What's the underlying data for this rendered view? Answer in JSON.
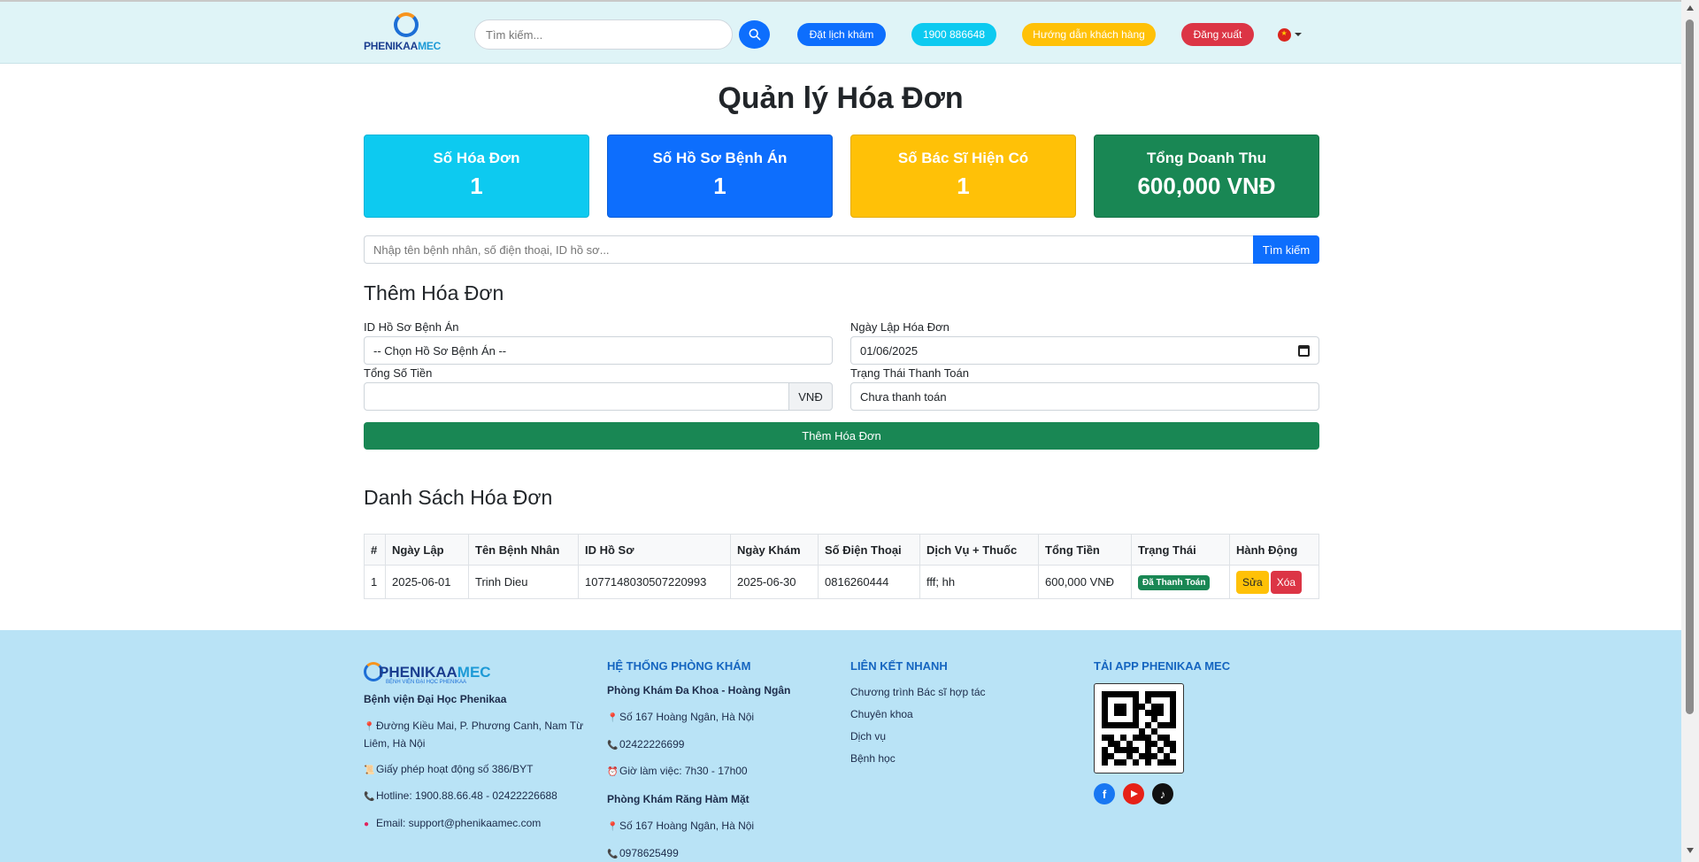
{
  "header": {
    "logo_main": "PHENIKAA",
    "logo_accent": "MEC",
    "search_placeholder": "Tìm kiếm...",
    "book_label": "Đặt lịch khám",
    "hotline_label": "1900 886648",
    "guide_label": "Hướng dẫn khách hàng",
    "logout_label": "Đăng xuất"
  },
  "page": {
    "title": "Quản lý Hóa Đơn"
  },
  "stats": [
    {
      "label": "Số Hóa Đơn",
      "value": "1",
      "color": "#0dcaf0"
    },
    {
      "label": "Số Hồ Sơ Bệnh Án",
      "value": "1",
      "color": "#0d6efd"
    },
    {
      "label": "Số Bác Sĩ Hiện Có",
      "value": "1",
      "color": "#ffc107"
    },
    {
      "label": "Tổng Doanh Thu",
      "value": "600,000 VNĐ",
      "color": "#198754"
    }
  ],
  "search": {
    "placeholder": "Nhập tên bệnh nhân, số điện thoại, ID hồ sơ...",
    "button": "Tìm kiếm"
  },
  "form": {
    "title": "Thêm Hóa Đơn",
    "record_label": "ID Hồ Sơ Bệnh Án",
    "record_value": "-- Chọn Hồ Sơ Bệnh Án --",
    "date_label": "Ngày Lập Hóa Đơn",
    "date_value": "01/06/2025",
    "amount_label": "Tổng Số Tiền",
    "amount_suffix": "VNĐ",
    "status_label": "Trạng Thái Thanh Toán",
    "status_value": "Chưa thanh toán",
    "submit": "Thêm Hóa Đơn"
  },
  "list": {
    "title": "Danh Sách Hóa Đơn",
    "columns": [
      "#",
      "Ngày Lập",
      "Tên Bệnh Nhân",
      "ID Hồ Sơ",
      "Ngày Khám",
      "Số Điện Thoại",
      "Dịch Vụ + Thuốc",
      "Tổng Tiền",
      "Trạng Thái",
      "Hành Động"
    ],
    "rows": [
      {
        "index": "1",
        "date": "2025-06-01",
        "patient": "Trinh Dieu",
        "record_id": "1077148030507220993",
        "visit_date": "2025-06-30",
        "phone": "0816260444",
        "services": "fff; hh",
        "total": "600,000 VNĐ",
        "status": "Đã Thanh Toán",
        "edit": "Sửa",
        "delete": "Xóa"
      }
    ]
  },
  "footer": {
    "logo_main": "PHENIKAA",
    "logo_accent": "MEC",
    "logo_sub": "BỆNH VIỆN ĐẠI HỌC PHENIKAA",
    "hospital": "Bệnh viện Đại Học Phenikaa",
    "address": "Đường Kiều Mai, P. Phương Canh, Nam Từ Liêm, Hà Nội",
    "license": "Giấy phép hoạt động số 386/BYT",
    "hotline": "Hotline: 1900.88.66.48 - 02422226688",
    "email": "Email: support@phenikaamec.com",
    "clinics_heading": "HỆ THỐNG PHÒNG KHÁM",
    "clinic1_name": "Phòng Khám Đa Khoa - Hoàng Ngân",
    "clinic1_address": "Số 167 Hoàng Ngân, Hà Nội",
    "clinic1_phone": "02422226699",
    "clinic1_hours": "Giờ làm việc: 7h30 - 17h00",
    "clinic2_name": "Phòng Khám Răng Hàm Mặt",
    "clinic2_address": "Số 167 Hoàng Ngân, Hà Nội",
    "clinic2_phone": "0978625499",
    "links_heading": "LIÊN KẾT NHANH",
    "links": [
      "Chương trình Bác sĩ hợp tác",
      "Chuyên khoa",
      "Dịch vụ",
      "Bệnh học"
    ],
    "app_heading": "TẢI APP PHENIKAA MEC",
    "social_icons": [
      "facebook-icon",
      "youtube-icon",
      "tiktok-icon"
    ]
  }
}
